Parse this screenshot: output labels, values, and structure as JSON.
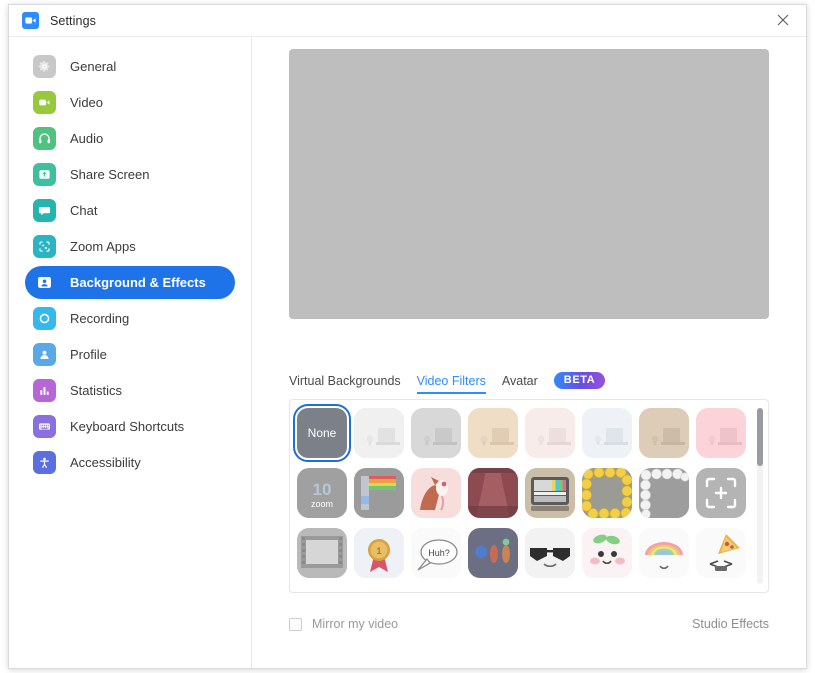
{
  "window": {
    "title": "Settings",
    "app_icon": "zoom-camera-icon",
    "close_icon": "close-icon"
  },
  "sidebar": {
    "items": [
      {
        "label": "General",
        "icon": "gear-icon",
        "color": "#c8c8c8",
        "active": false
      },
      {
        "label": "Video",
        "icon": "camera-icon",
        "color": "#97c93d",
        "active": false
      },
      {
        "label": "Audio",
        "icon": "headphones-icon",
        "color": "#4ec27f",
        "active": false
      },
      {
        "label": "Share Screen",
        "icon": "screen-share-icon",
        "color": "#3ec0a0",
        "active": false
      },
      {
        "label": "Chat",
        "icon": "chat-bubble-icon",
        "color": "#23b5ae",
        "active": false
      },
      {
        "label": "Zoom Apps",
        "icon": "apps-icon",
        "color": "#29b5c4",
        "active": false
      },
      {
        "label": "Background & Effects",
        "icon": "person-frame-icon",
        "color": "#ffffff",
        "active": true
      },
      {
        "label": "Recording",
        "icon": "record-icon",
        "color": "#35b8f0",
        "active": false
      },
      {
        "label": "Profile",
        "icon": "person-icon",
        "color": "#5aa8e8",
        "active": false
      },
      {
        "label": "Statistics",
        "icon": "bar-chart-icon",
        "color": "#b866d6",
        "active": false
      },
      {
        "label": "Keyboard Shortcuts",
        "icon": "keyboard-icon",
        "color": "#8b6fe0",
        "active": false
      },
      {
        "label": "Accessibility",
        "icon": "accessibility-icon",
        "color": "#5b6fe0",
        "active": false
      }
    ],
    "active_color": "#1E73E8"
  },
  "main": {
    "video_preview": {
      "name": "video-preview",
      "color": "#bebebe"
    },
    "tabs": [
      {
        "label": "Virtual Backgrounds",
        "active": false
      },
      {
        "label": "Video Filters",
        "active": true
      },
      {
        "label": "Avatar",
        "active": false
      }
    ],
    "beta_badge": "BETA",
    "active_tab_color": "#2D8CFF",
    "filters": {
      "rows": 3,
      "columns": 8,
      "selected": "None",
      "items": [
        {
          "name": "None",
          "type": "none",
          "label": "None",
          "bg": "#7c8088"
        },
        {
          "name": "filter-tile",
          "type": "scene",
          "bg": "#f0f0f0"
        },
        {
          "name": "filter-tile",
          "type": "scene",
          "bg": "#d8d8d8"
        },
        {
          "name": "filter-tile",
          "type": "scene",
          "bg": "#f0ddc6"
        },
        {
          "name": "filter-tile",
          "type": "scene",
          "bg": "#f7ecea"
        },
        {
          "name": "filter-tile",
          "type": "scene",
          "bg": "#eef1f5"
        },
        {
          "name": "filter-tile",
          "type": "scene",
          "bg": "#ddccb8"
        },
        {
          "name": "filter-tile",
          "type": "scene",
          "bg": "#fbd3d9"
        },
        {
          "name": "zoom-10-anniversary-tile",
          "type": "zoom10",
          "label": "zoom",
          "number": "10",
          "bg": "#a0a0a0"
        },
        {
          "name": "rainbow-tile",
          "type": "rainbow",
          "bg": "#9b9b9b"
        },
        {
          "name": "fox-tile",
          "type": "fox",
          "bg": "#f7dedc"
        },
        {
          "name": "curtain-tile",
          "type": "curtain",
          "bg": "#b56f72"
        },
        {
          "name": "tv-frame-tile",
          "type": "tv",
          "bg": "#cabea8"
        },
        {
          "name": "emoji-border-tile",
          "type": "emoji",
          "bg": "#aaa8a0"
        },
        {
          "name": "pearls-tile",
          "type": "pearls",
          "bg": "#9d9d9d"
        },
        {
          "name": "add-custom-tile",
          "type": "add",
          "bg": "#b4b4b4"
        },
        {
          "name": "film-frame-tile",
          "type": "film",
          "bg": "#b9b9b9"
        },
        {
          "name": "award-ribbon-tile",
          "type": "ribbon",
          "bg": "#eef1f5"
        },
        {
          "name": "huh-bubble-tile",
          "type": "huh",
          "label": "Huh?",
          "bg": "#fafafa"
        },
        {
          "name": "lights-tile",
          "type": "lights",
          "bg": "#6c6f83"
        },
        {
          "name": "sunglasses-tile",
          "type": "sunglasses",
          "bg": "#f2f2f2"
        },
        {
          "name": "cute-face-tile",
          "type": "cuteface",
          "bg": "#fbf3f3"
        },
        {
          "name": "rainbow-arc-tile",
          "type": "arc",
          "bg": "#fafafa"
        },
        {
          "name": "pizza-tile",
          "type": "pizza",
          "bg": "#fafafa"
        }
      ]
    },
    "mirror_checkbox": {
      "label": "Mirror my video",
      "checked": false
    },
    "studio_effects_link": "Studio Effects"
  }
}
